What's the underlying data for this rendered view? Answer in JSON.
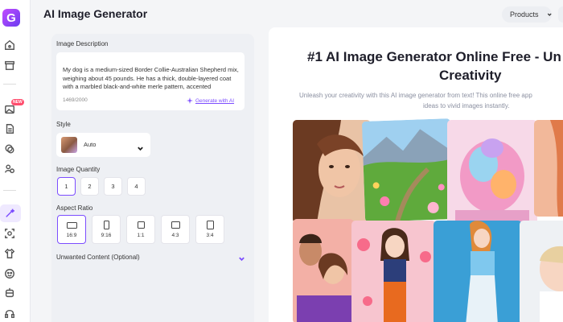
{
  "app": {
    "logo_letter": "G"
  },
  "header": {
    "title": "AI Image Generator",
    "products_label": "Products"
  },
  "sidebar": {
    "new_badge": "NEW",
    "icons": [
      "home-icon",
      "archive-icon",
      "image-new-icon",
      "document-icon",
      "layers-icon",
      "people-icon",
      "generator-icon",
      "face-swap-icon",
      "shirt-icon",
      "sticker-icon",
      "robot-icon",
      "headphones-icon"
    ]
  },
  "form": {
    "description": {
      "label": "Image Description",
      "value": "My dog is a medium-sized Border Collie-Australian Shepherd mix, weighing about 45 pounds. He has a thick, double-layered coat with a marbled black-and-white merle pattern, accented",
      "count": "1469/2000",
      "generate_ai": "Generate with AI"
    },
    "style": {
      "label": "Style",
      "value": "Auto"
    },
    "quantity": {
      "label": "Image Quantity",
      "options": [
        "1",
        "2",
        "3",
        "4"
      ],
      "selected": "1"
    },
    "aspect": {
      "label": "Aspect Ratio",
      "options": [
        "16:9",
        "9:16",
        "1:1",
        "4:3",
        "3:4"
      ],
      "selected": "16:9"
    },
    "unwanted": {
      "label": "Unwanted Content (Optional)"
    }
  },
  "hero": {
    "title_line1": "#1 AI Image Generator Online Free - Un",
    "title_line2": "Creativity",
    "subtitle_line1": "Unleash your creativity with this AI image generator from text! This online free app",
    "subtitle_line2": "ideas to vivid images instantly."
  },
  "colors": {
    "accent": "#7c4dff",
    "badge": "#ff4d6d"
  }
}
